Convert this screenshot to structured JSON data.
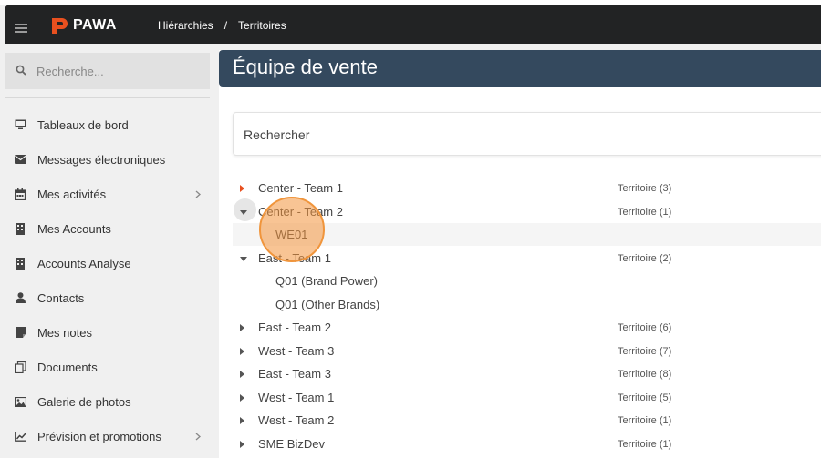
{
  "app": {
    "logo_text": "PAWA",
    "breadcrumb": [
      "Hiérarchies",
      "/",
      "Territoires"
    ]
  },
  "sidebar": {
    "search_placeholder": "Recherche...",
    "items": [
      {
        "label": "Tableaux de bord",
        "icon": "monitor-icon",
        "chevron": false
      },
      {
        "label": "Messages électroniques",
        "icon": "envelope-icon",
        "chevron": false
      },
      {
        "label": "Mes activités",
        "icon": "calendar-icon",
        "chevron": true
      },
      {
        "label": "Mes Accounts",
        "icon": "building-icon",
        "chevron": false
      },
      {
        "label": "Accounts Analyse",
        "icon": "building-icon",
        "chevron": false
      },
      {
        "label": "Contacts",
        "icon": "user-icon",
        "chevron": false
      },
      {
        "label": "Mes notes",
        "icon": "note-icon",
        "chevron": false
      },
      {
        "label": "Documents",
        "icon": "documents-icon",
        "chevron": false
      },
      {
        "label": "Galerie de photos",
        "icon": "image-icon",
        "chevron": false
      },
      {
        "label": "Prévision et promotions",
        "icon": "chart-line-icon",
        "chevron": true
      }
    ]
  },
  "main": {
    "title": "Équipe de vente",
    "search_placeholder": "Rechercher",
    "tree": [
      {
        "label": "Center - Team 1",
        "count": "Territoire (3)",
        "level": 0,
        "caret": "right-orange"
      },
      {
        "label": "Center - Team 2",
        "count": "Territoire (1)",
        "level": 0,
        "caret": "down-selected"
      },
      {
        "label": "WE01",
        "count": "",
        "level": 1,
        "caret": "none"
      },
      {
        "label": "East - Team 1",
        "count": "Territoire (2)",
        "level": 0,
        "caret": "down"
      },
      {
        "label": "Q01 (Brand Power)",
        "count": "",
        "level": 1,
        "caret": "none"
      },
      {
        "label": "Q01 (Other Brands)",
        "count": "",
        "level": 1,
        "caret": "none"
      },
      {
        "label": "East - Team 2",
        "count": "Territoire (6)",
        "level": 0,
        "caret": "right"
      },
      {
        "label": "West - Team 3",
        "count": "Territoire (7)",
        "level": 0,
        "caret": "right"
      },
      {
        "label": "East - Team 3",
        "count": "Territoire (8)",
        "level": 0,
        "caret": "right"
      },
      {
        "label": "West - Team 1",
        "count": "Territoire (5)",
        "level": 0,
        "caret": "right"
      },
      {
        "label": "West - Team 2",
        "count": "Territoire (1)",
        "level": 0,
        "caret": "right"
      },
      {
        "label": "SME BizDev",
        "count": "Territoire (1)",
        "level": 0,
        "caret": "right"
      }
    ]
  },
  "colors": {
    "topbar": "#222324",
    "header": "#34495e",
    "accent": "#e8501f",
    "click_marker": "#f0953c"
  }
}
